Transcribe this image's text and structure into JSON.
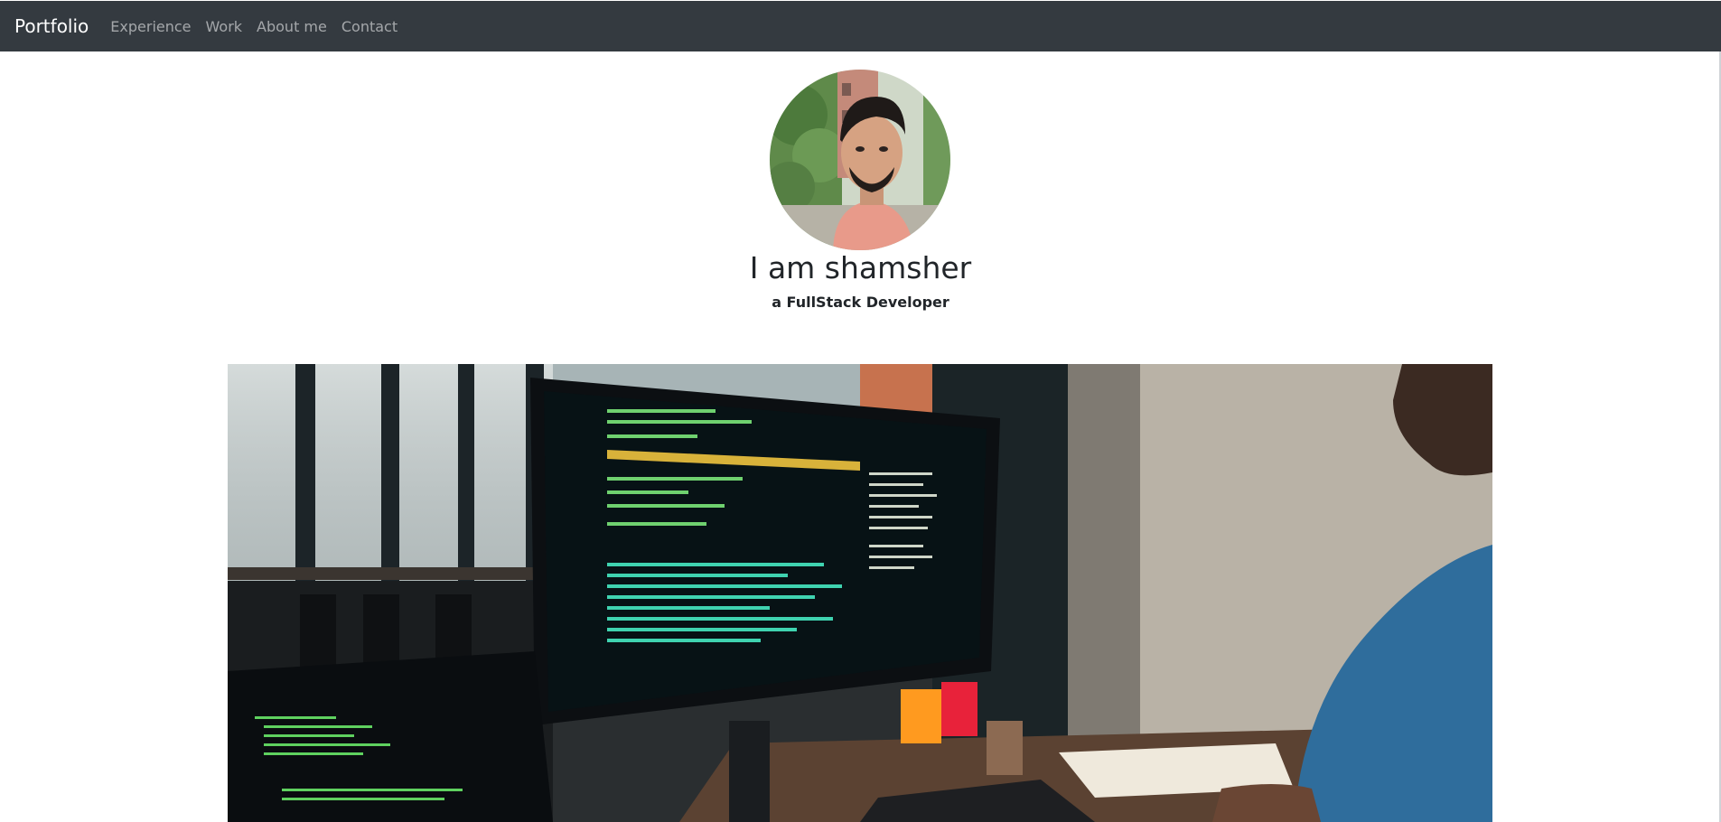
{
  "navbar": {
    "brand": "Portfolio",
    "links": [
      "Experience",
      "Work",
      "About me",
      "Contact"
    ]
  },
  "profile": {
    "heading": "I am shamsher",
    "subheading": "a FullStack Developer"
  },
  "colors": {
    "navbar_bg": "#343a40",
    "brand": "#ffffff",
    "nav_link": "rgba(255,255,255,0.55)",
    "text": "#212529"
  },
  "icons": {
    "avatar": "profile-photo",
    "hero": "developer-workspace-photo"
  }
}
